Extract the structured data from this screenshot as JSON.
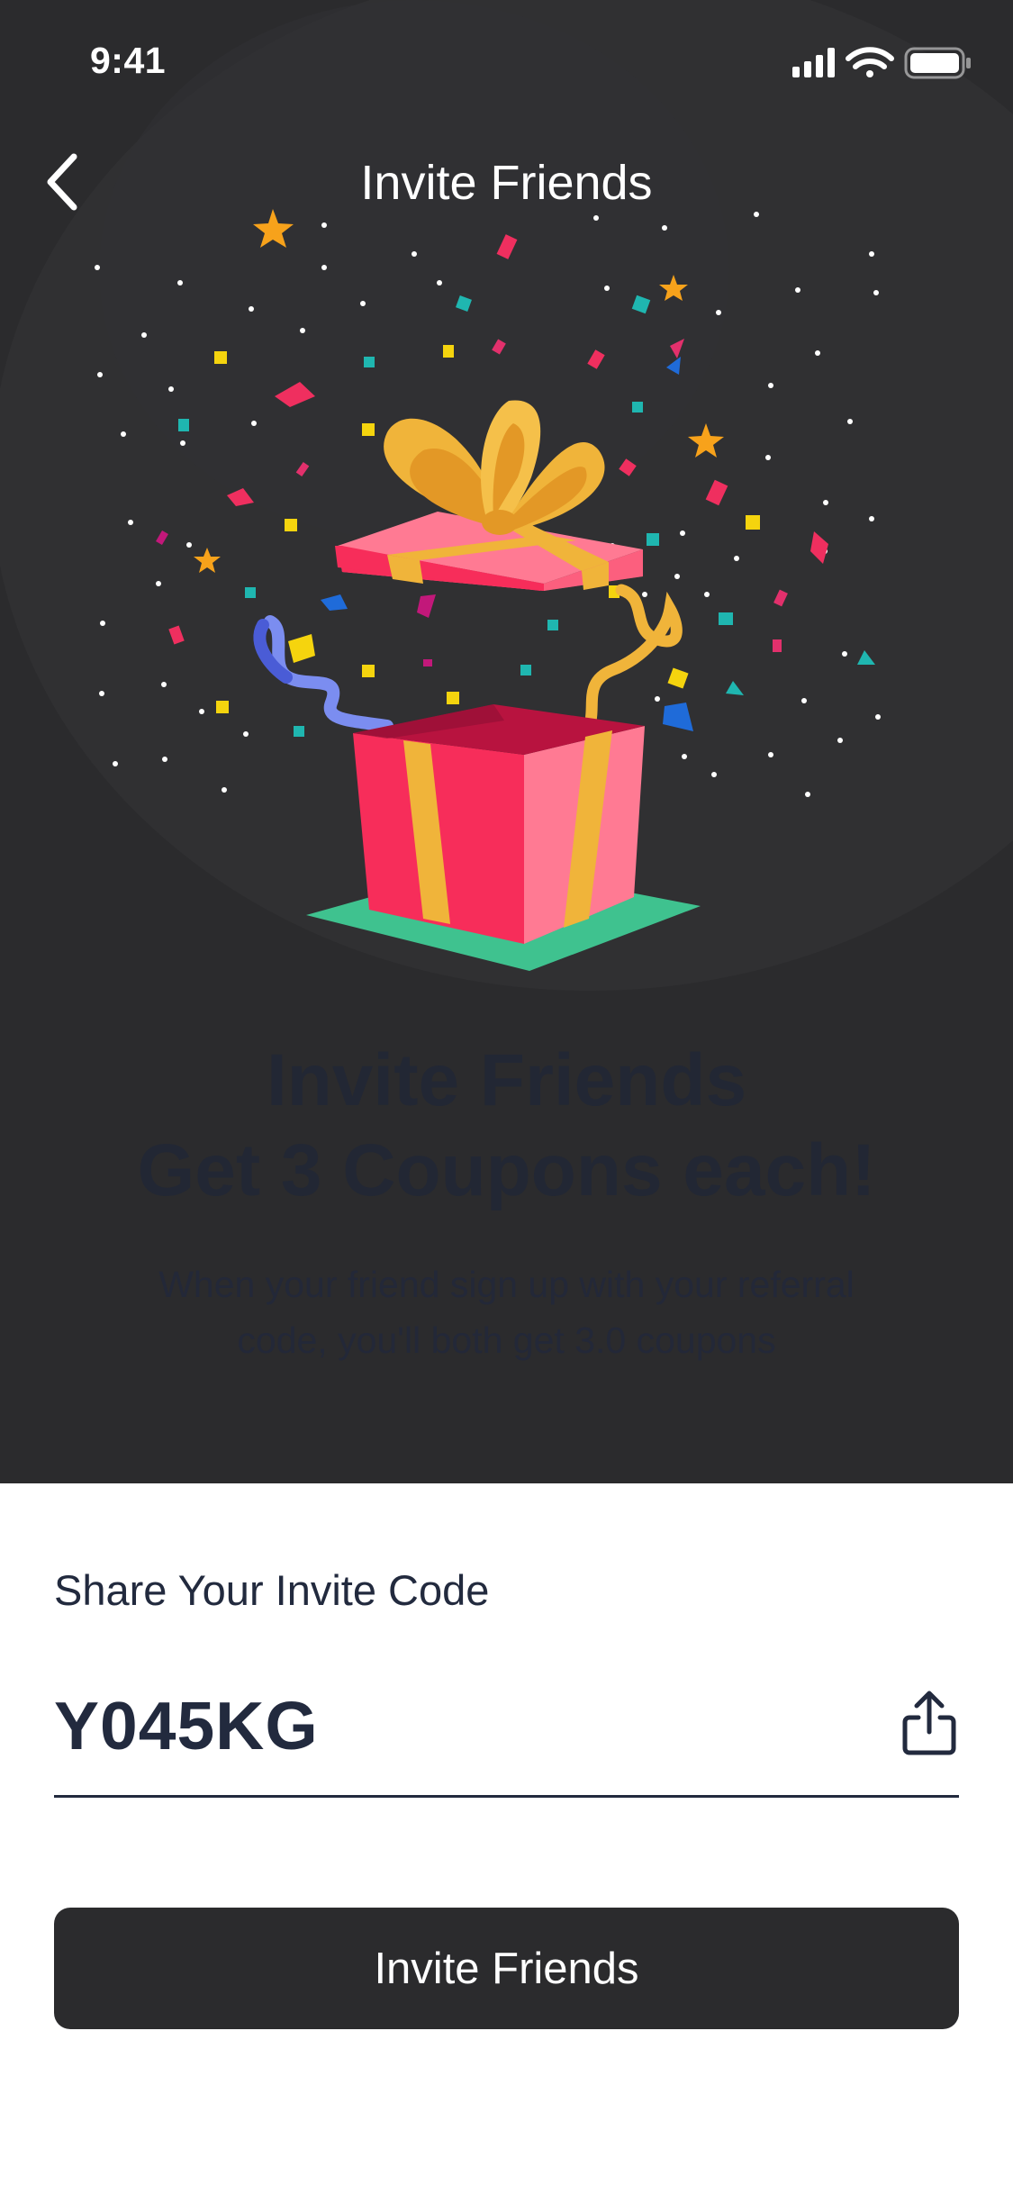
{
  "status_bar": {
    "time": "9:41"
  },
  "nav": {
    "title": "Invite Friends"
  },
  "hero": {
    "headline_line1": "Invite Friends",
    "headline_line2": "Get 3 Coupons each!",
    "subtext_line1": "When your friend sign up with your referral",
    "subtext_line2": "code, you'll both get 3.0 coupons"
  },
  "share": {
    "label": "Share Your Invite Code",
    "code": "Y045KG"
  },
  "cta": {
    "label": "Invite Friends"
  },
  "colors": {
    "hero_background": "#2b2b2d",
    "text_dark": "#222a3e",
    "button_background": "#2b2b2d",
    "gift_pink": "#f72d5a",
    "gift_light_pink": "#ff7a93",
    "ribbon_gold": "#f0b43a",
    "base_green": "#3fc28f"
  },
  "icons": [
    "chevron-left-icon",
    "signal-icon",
    "wifi-icon",
    "battery-icon",
    "share-icon",
    "gift-illustration"
  ]
}
